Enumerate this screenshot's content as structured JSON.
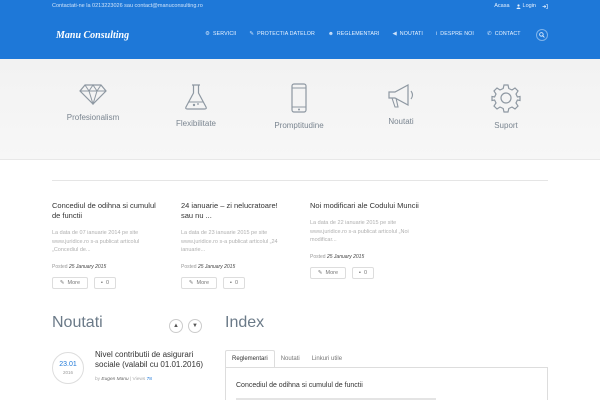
{
  "topbar": {
    "contact_text": "Contactati-ne la 0213223026 sau contact@manuconsulting.ro",
    "home_label": "Acasa",
    "login_label": "Login"
  },
  "header": {
    "logo": "Manu Consulting",
    "nav": [
      {
        "label": "SERVICII",
        "icon": "gear-icon"
      },
      {
        "label": "PROTECTIA DATELOR",
        "icon": "wrench-icon"
      },
      {
        "label": "REGLEMENTARI",
        "icon": "users-icon"
      },
      {
        "label": "NOUTATI",
        "icon": "speaker-icon"
      },
      {
        "label": "DESPRE NOI",
        "icon": "info-icon"
      },
      {
        "label": "CONTACT",
        "icon": "phone-icon"
      }
    ]
  },
  "features": [
    {
      "label": "Profesionalism",
      "icon": "diamond-icon"
    },
    {
      "label": "Flexibilitate",
      "icon": "flask-icon"
    },
    {
      "label": "Promptitudine",
      "icon": "mobile-icon"
    },
    {
      "label": "Noutati",
      "icon": "megaphone-icon"
    },
    {
      "label": "Suport",
      "icon": "cog-icon"
    }
  ],
  "posts": [
    {
      "title": "Concediul de odihna si cumulul de functii",
      "excerpt": "La data de 07 ianuarie 2014 pe site www.juridice.ro s-a publicat articolul „Concediul de...",
      "posted_label": "Posted",
      "date": "25 January 2015",
      "more_label": "More",
      "comments": "0"
    },
    {
      "title": "24 ianuarie – zi nelucratoare! sau nu ...",
      "excerpt": "La data de 23 ianuarie 2015 pe site www.juridice.ro s-a publicat articolul „24 ianuarie...",
      "posted_label": "Posted",
      "date": "25 January 2015",
      "more_label": "More",
      "comments": "0"
    },
    {
      "title": "Noi modificari ale Codului Muncii",
      "excerpt": "La data de 22 ianuarie 2015 pe site www.juridice.ro s-a publicat articolul „Noi modificar...",
      "posted_label": "Posted",
      "date": "25 January 2015",
      "more_label": "More",
      "comments": "0"
    }
  ],
  "noutati": {
    "title": "Noutati",
    "item": {
      "day": "23.01",
      "year": "2016",
      "title": "Nivel contributii de asigurari sociale (valabil cu 01.01.2016)",
      "by_label": "by",
      "author": "Eugen Manu",
      "views_label": "Views",
      "views": "78"
    }
  },
  "index": {
    "title": "Index",
    "tabs": [
      "Reglementari",
      "Noutati",
      "Linkuri utile"
    ],
    "entry": "Concediul de odihna si cumulul de functii"
  },
  "colors": {
    "header_bg": "#1e78d8",
    "accent": "#1e78d8"
  }
}
